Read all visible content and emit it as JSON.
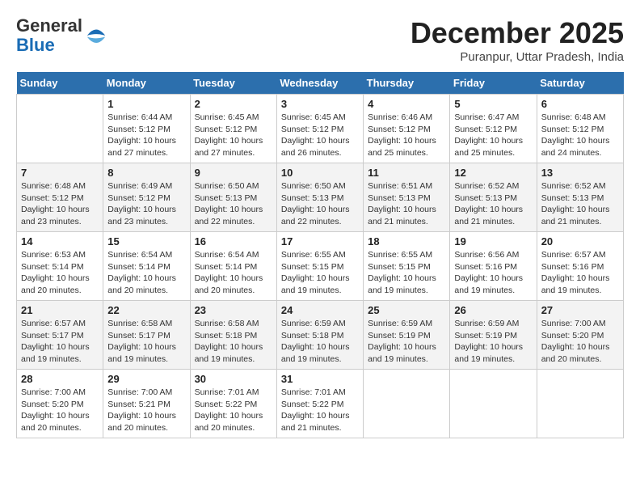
{
  "header": {
    "logo_general": "General",
    "logo_blue": "Blue",
    "month_title": "December 2025",
    "location": "Puranpur, Uttar Pradesh, India"
  },
  "days_of_week": [
    "Sunday",
    "Monday",
    "Tuesday",
    "Wednesday",
    "Thursday",
    "Friday",
    "Saturday"
  ],
  "weeks": [
    [
      {
        "day": "",
        "info": ""
      },
      {
        "day": "1",
        "info": "Sunrise: 6:44 AM\nSunset: 5:12 PM\nDaylight: 10 hours\nand 27 minutes."
      },
      {
        "day": "2",
        "info": "Sunrise: 6:45 AM\nSunset: 5:12 PM\nDaylight: 10 hours\nand 27 minutes."
      },
      {
        "day": "3",
        "info": "Sunrise: 6:45 AM\nSunset: 5:12 PM\nDaylight: 10 hours\nand 26 minutes."
      },
      {
        "day": "4",
        "info": "Sunrise: 6:46 AM\nSunset: 5:12 PM\nDaylight: 10 hours\nand 25 minutes."
      },
      {
        "day": "5",
        "info": "Sunrise: 6:47 AM\nSunset: 5:12 PM\nDaylight: 10 hours\nand 25 minutes."
      },
      {
        "day": "6",
        "info": "Sunrise: 6:48 AM\nSunset: 5:12 PM\nDaylight: 10 hours\nand 24 minutes."
      }
    ],
    [
      {
        "day": "7",
        "info": "Sunrise: 6:48 AM\nSunset: 5:12 PM\nDaylight: 10 hours\nand 23 minutes."
      },
      {
        "day": "8",
        "info": "Sunrise: 6:49 AM\nSunset: 5:12 PM\nDaylight: 10 hours\nand 23 minutes."
      },
      {
        "day": "9",
        "info": "Sunrise: 6:50 AM\nSunset: 5:13 PM\nDaylight: 10 hours\nand 22 minutes."
      },
      {
        "day": "10",
        "info": "Sunrise: 6:50 AM\nSunset: 5:13 PM\nDaylight: 10 hours\nand 22 minutes."
      },
      {
        "day": "11",
        "info": "Sunrise: 6:51 AM\nSunset: 5:13 PM\nDaylight: 10 hours\nand 21 minutes."
      },
      {
        "day": "12",
        "info": "Sunrise: 6:52 AM\nSunset: 5:13 PM\nDaylight: 10 hours\nand 21 minutes."
      },
      {
        "day": "13",
        "info": "Sunrise: 6:52 AM\nSunset: 5:13 PM\nDaylight: 10 hours\nand 21 minutes."
      }
    ],
    [
      {
        "day": "14",
        "info": "Sunrise: 6:53 AM\nSunset: 5:14 PM\nDaylight: 10 hours\nand 20 minutes."
      },
      {
        "day": "15",
        "info": "Sunrise: 6:54 AM\nSunset: 5:14 PM\nDaylight: 10 hours\nand 20 minutes."
      },
      {
        "day": "16",
        "info": "Sunrise: 6:54 AM\nSunset: 5:14 PM\nDaylight: 10 hours\nand 20 minutes."
      },
      {
        "day": "17",
        "info": "Sunrise: 6:55 AM\nSunset: 5:15 PM\nDaylight: 10 hours\nand 19 minutes."
      },
      {
        "day": "18",
        "info": "Sunrise: 6:55 AM\nSunset: 5:15 PM\nDaylight: 10 hours\nand 19 minutes."
      },
      {
        "day": "19",
        "info": "Sunrise: 6:56 AM\nSunset: 5:16 PM\nDaylight: 10 hours\nand 19 minutes."
      },
      {
        "day": "20",
        "info": "Sunrise: 6:57 AM\nSunset: 5:16 PM\nDaylight: 10 hours\nand 19 minutes."
      }
    ],
    [
      {
        "day": "21",
        "info": "Sunrise: 6:57 AM\nSunset: 5:17 PM\nDaylight: 10 hours\nand 19 minutes."
      },
      {
        "day": "22",
        "info": "Sunrise: 6:58 AM\nSunset: 5:17 PM\nDaylight: 10 hours\nand 19 minutes."
      },
      {
        "day": "23",
        "info": "Sunrise: 6:58 AM\nSunset: 5:18 PM\nDaylight: 10 hours\nand 19 minutes."
      },
      {
        "day": "24",
        "info": "Sunrise: 6:59 AM\nSunset: 5:18 PM\nDaylight: 10 hours\nand 19 minutes."
      },
      {
        "day": "25",
        "info": "Sunrise: 6:59 AM\nSunset: 5:19 PM\nDaylight: 10 hours\nand 19 minutes."
      },
      {
        "day": "26",
        "info": "Sunrise: 6:59 AM\nSunset: 5:19 PM\nDaylight: 10 hours\nand 19 minutes."
      },
      {
        "day": "27",
        "info": "Sunrise: 7:00 AM\nSunset: 5:20 PM\nDaylight: 10 hours\nand 20 minutes."
      }
    ],
    [
      {
        "day": "28",
        "info": "Sunrise: 7:00 AM\nSunset: 5:20 PM\nDaylight: 10 hours\nand 20 minutes."
      },
      {
        "day": "29",
        "info": "Sunrise: 7:00 AM\nSunset: 5:21 PM\nDaylight: 10 hours\nand 20 minutes."
      },
      {
        "day": "30",
        "info": "Sunrise: 7:01 AM\nSunset: 5:22 PM\nDaylight: 10 hours\nand 20 minutes."
      },
      {
        "day": "31",
        "info": "Sunrise: 7:01 AM\nSunset: 5:22 PM\nDaylight: 10 hours\nand 21 minutes."
      },
      {
        "day": "",
        "info": ""
      },
      {
        "day": "",
        "info": ""
      },
      {
        "day": "",
        "info": ""
      }
    ]
  ]
}
